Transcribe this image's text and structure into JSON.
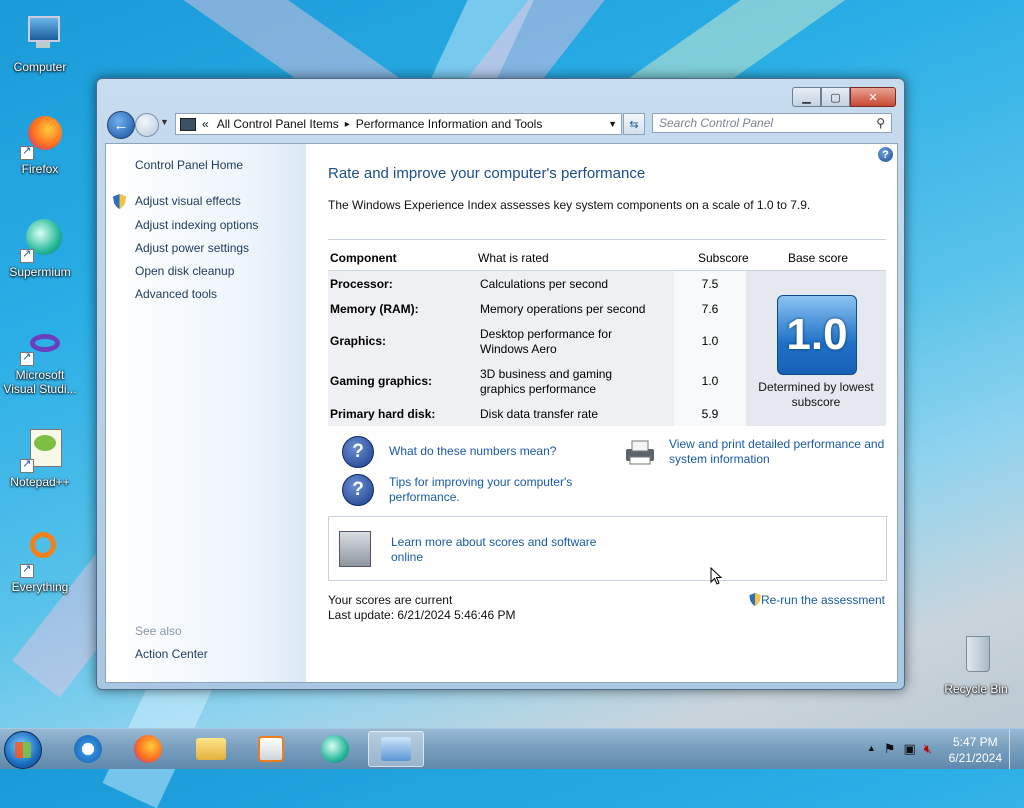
{
  "desktop": {
    "icons": [
      {
        "label": "Computer",
        "icon": "computer-icon"
      },
      {
        "label": "Firefox",
        "icon": "firefox-icon"
      },
      {
        "label": "Supermium",
        "icon": "supermium-icon"
      },
      {
        "label": "Microsoft Visual Studi...",
        "icon": "visual-studio-icon"
      },
      {
        "label": "Notepad++",
        "icon": "notepad-plus-plus-icon"
      },
      {
        "label": "Everything",
        "icon": "everything-icon"
      },
      {
        "label": "Recycle Bin",
        "icon": "recycle-bin-icon"
      }
    ]
  },
  "window": {
    "caption": {
      "minimize": "▁",
      "maximize": "▢",
      "close": "✕"
    },
    "address": {
      "prefix": "«",
      "crumb1": "All Control Panel Items",
      "separator": "▸",
      "crumb2": "Performance Information and Tools"
    },
    "search": {
      "placeholder": "Search Control Panel"
    },
    "sidebar": {
      "home": "Control Panel Home",
      "links": [
        "Adjust visual effects",
        "Adjust indexing options",
        "Adjust power settings",
        "Open disk cleanup",
        "Advanced tools"
      ],
      "see_also_heading": "See also",
      "see_also_link": "Action Center"
    },
    "main": {
      "help": "?",
      "title": "Rate and improve your computer's performance",
      "description": "The Windows Experience Index assesses key system components on a scale of 1.0 to 7.9.",
      "table": {
        "headers": {
          "component": "Component",
          "rated": "What is rated",
          "subscore": "Subscore",
          "base": "Base score"
        },
        "rows": [
          {
            "component": "Processor:",
            "rated": "Calculations per second",
            "subscore": "7.5"
          },
          {
            "component": "Memory (RAM):",
            "rated": "Memory operations per second",
            "subscore": "7.6"
          },
          {
            "component": "Graphics:",
            "rated": "Desktop performance for Windows Aero",
            "subscore": "1.0"
          },
          {
            "component": "Gaming graphics:",
            "rated": "3D business and gaming graphics performance",
            "subscore": "1.0"
          },
          {
            "component": "Primary hard disk:",
            "rated": "Disk data transfer rate",
            "subscore": "5.9"
          }
        ],
        "base_score": "1.0",
        "base_note": "Determined by lowest subscore"
      },
      "links": {
        "numbers": "What do these numbers mean?",
        "tips": "Tips for improving your computer's performance.",
        "print": "View and print detailed performance and system information",
        "learn": "Learn more about scores and software online"
      },
      "status": {
        "current": "Your scores are current",
        "last_update": "Last update: 6/21/2024 5:46:46 PM"
      },
      "rerun": "Re-run the assessment"
    }
  },
  "taskbar": {
    "apps": [
      "start-orb",
      "internet-explorer-icon",
      "firefox-icon",
      "file-explorer-icon",
      "media-player-icon",
      "supermium-icon",
      "performance-tools-icon"
    ],
    "clock": {
      "time": "5:47 PM",
      "date": "6/21/2024"
    },
    "tray": {
      "expand": "▲"
    }
  }
}
